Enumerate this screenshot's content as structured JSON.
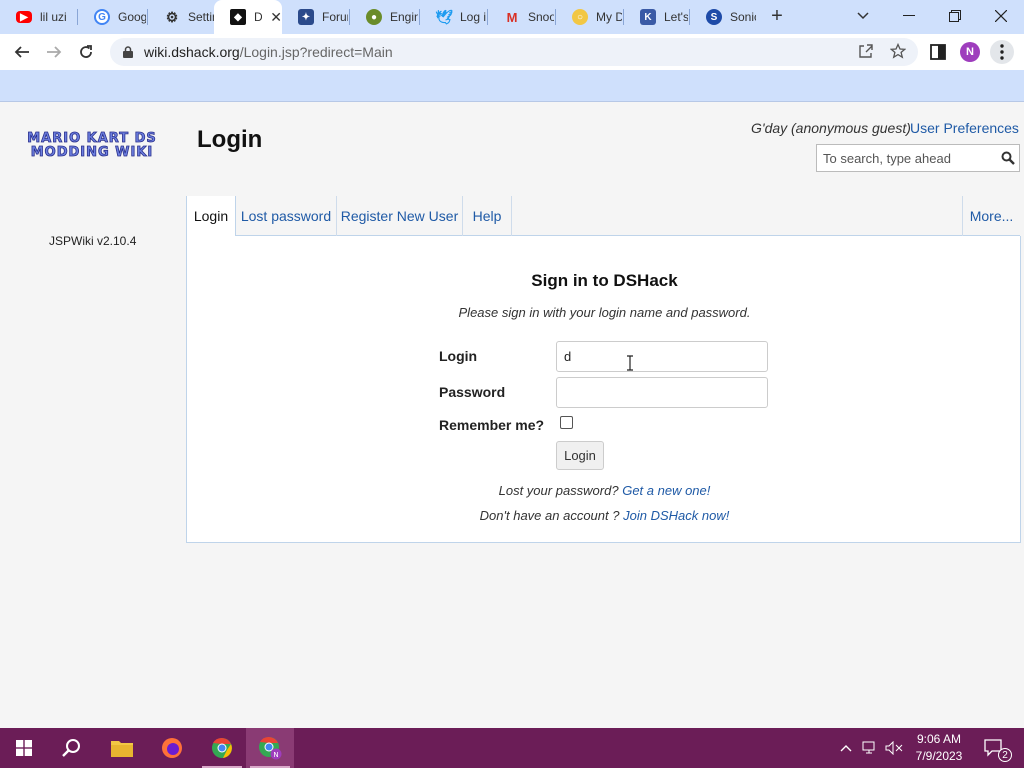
{
  "browser": {
    "tabs": [
      {
        "title": "lil uzi",
        "icon": "youtube-icon",
        "color": "#ff0000"
      },
      {
        "title": "Goog",
        "icon": "google-icon",
        "color": "#4285f4"
      },
      {
        "title": "Settin",
        "icon": "gear-icon",
        "color": "#333333"
      },
      {
        "title": "D",
        "icon": "dshack-icon",
        "color": "#111111",
        "active": true
      },
      {
        "title": "Forun",
        "icon": "forum-icon",
        "color": "#2b4a8b"
      },
      {
        "title": "Engin",
        "icon": "engine-icon",
        "color": "#6a8c2a"
      },
      {
        "title": "Log i",
        "icon": "twitter-icon",
        "color": "#1d9bf0"
      },
      {
        "title": "Snoo",
        "icon": "gmail-icon",
        "color": "#d93025"
      },
      {
        "title": "My D",
        "icon": "lightbulb-icon",
        "color": "#f2c744"
      },
      {
        "title": "Let's",
        "icon": "kb-icon",
        "color": "#3a5aa6"
      },
      {
        "title": "Sonic",
        "icon": "sonic-icon",
        "color": "#1e4ba8"
      }
    ],
    "url_domain": "wiki.dshack.org",
    "url_path": "/Login.jsp?redirect=Main",
    "profile_initial": "N"
  },
  "site": {
    "logo_text": "MARIO KART DS MODDING WIKI",
    "page_title": "Login",
    "greeting": "G'day (anonymous guest)",
    "user_preferences": "User Preferences",
    "search_placeholder": "To search, type ahead",
    "version": "JSPWiki v2.10.4"
  },
  "tabs": {
    "login": "Login",
    "lost_password": "Lost password",
    "register": "Register New User",
    "help": "Help",
    "more": "More..."
  },
  "form": {
    "title": "Sign in to DSHack",
    "subtitle": "Please sign in with your login name and password.",
    "login_label": "Login",
    "login_value": "d",
    "password_label": "Password",
    "password_value": "",
    "remember_label": "Remember me?",
    "submit": "Login",
    "lost_prefix": "Lost your password?",
    "lost_link": "Get a new one!",
    "account_prefix": "Don't have an account ?",
    "account_link": "Join DSHack now!"
  },
  "taskbar": {
    "time": "9:06 AM",
    "date": "7/9/2023",
    "notifications": "2"
  }
}
